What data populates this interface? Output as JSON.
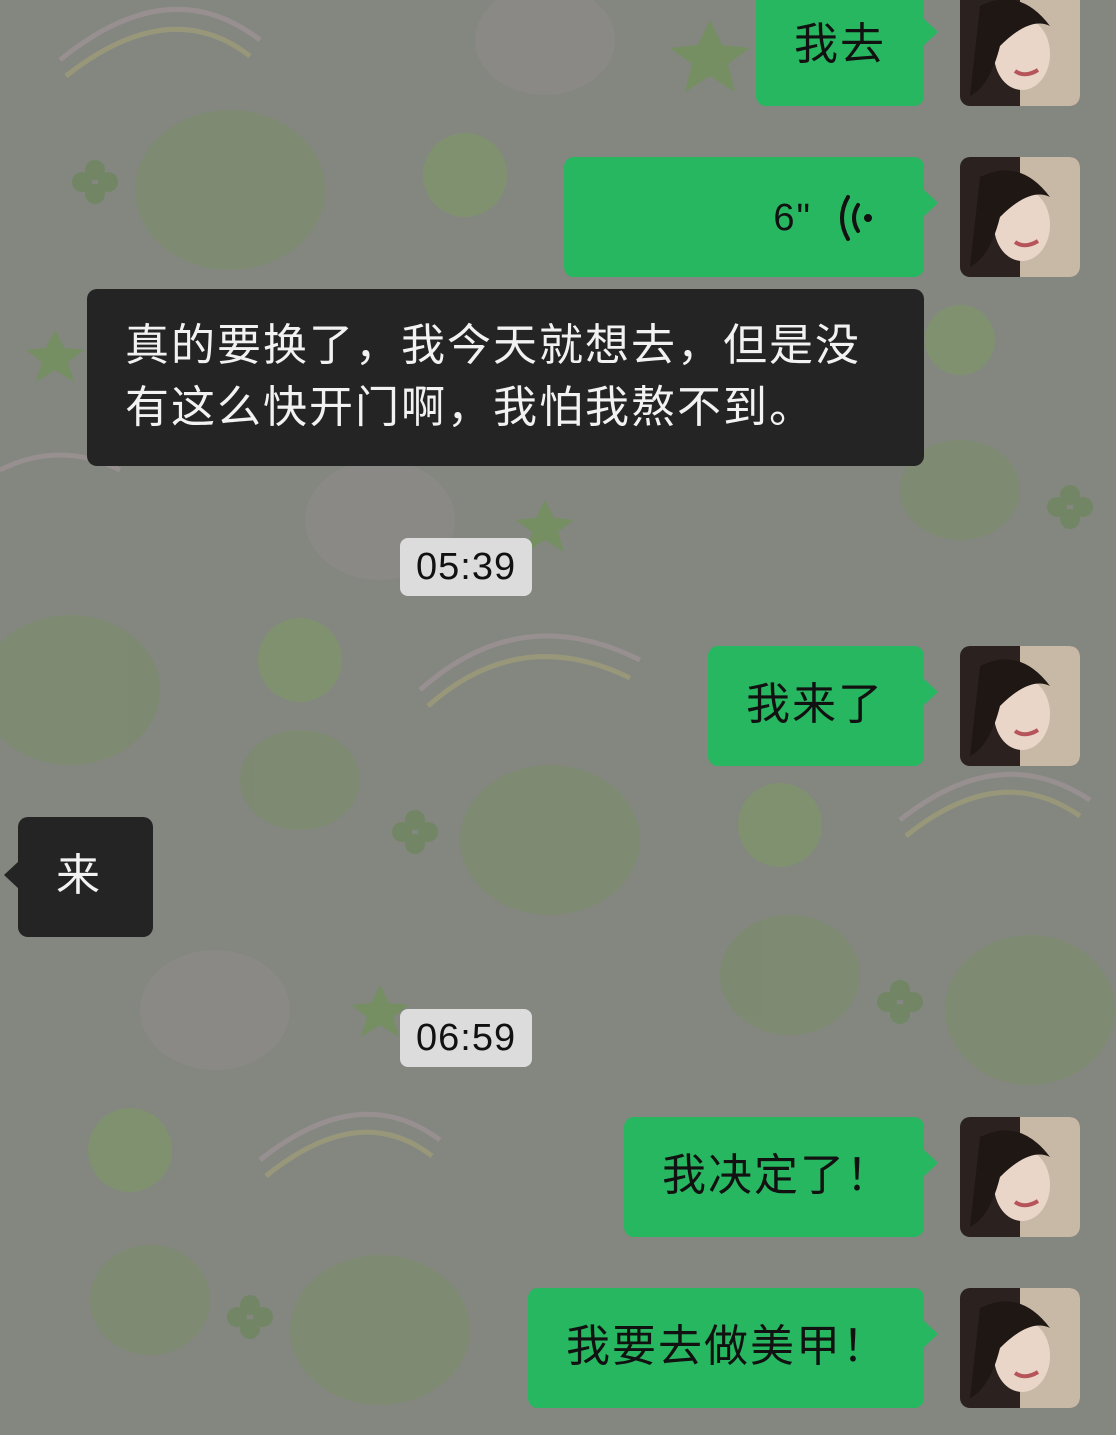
{
  "chat": {
    "messages": [
      {
        "from": "me",
        "text": "我去"
      },
      {
        "from": "me",
        "type": "voice",
        "duration": "6\""
      },
      {
        "from": "peer",
        "lines": [
          "真的要换了，我今天就想去，但是没",
          "有这么快开门啊，我怕我熬不到。"
        ]
      },
      {
        "type": "timestamp",
        "text": "05:39"
      },
      {
        "from": "me",
        "text": "我来了"
      },
      {
        "from": "peer",
        "text": "来"
      },
      {
        "type": "timestamp",
        "text": "06:59"
      },
      {
        "from": "me",
        "text": "我决定了！"
      },
      {
        "from": "me",
        "text": "我要去做美甲！"
      }
    ]
  },
  "theme": {
    "my_bubble_color": "#27b760",
    "peer_bubble_color": "#242424",
    "wallpaper": "frog-and-pig cartoon pattern"
  },
  "icons": {
    "voice": "voice-wave-icon",
    "avatar": "user-avatar-photo"
  }
}
